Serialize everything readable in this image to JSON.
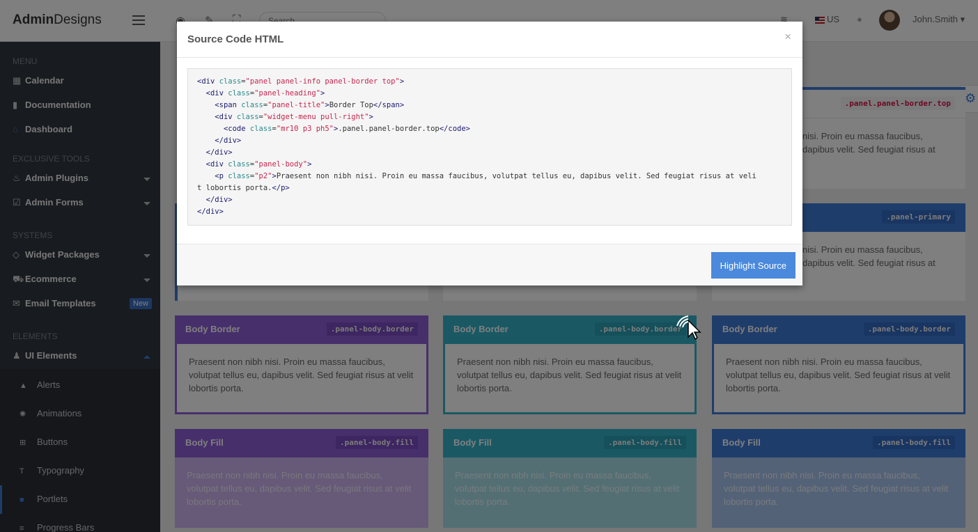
{
  "header": {
    "logo_bold": "Admin",
    "logo_rest": "Designs",
    "search_placeholder": "Search...",
    "language": "US",
    "username": "John.Smith"
  },
  "sidebar": {
    "sections": [
      "MENU",
      "EXCLUSIVE TOOLS",
      "SYSTEMS",
      "ELEMENTS"
    ],
    "menu": [
      {
        "label": "Calendar",
        "icon": "calendar-icon"
      },
      {
        "label": "Documentation",
        "icon": "book-icon"
      },
      {
        "label": "Dashboard",
        "icon": "home-icon"
      }
    ],
    "tools": [
      {
        "label": "Admin Plugins",
        "icon": "fire-icon"
      },
      {
        "label": "Admin Forms",
        "icon": "check-square-icon"
      }
    ],
    "systems": [
      {
        "label": "Widget Packages",
        "icon": "diamond-icon"
      },
      {
        "label": "Ecommerce",
        "icon": "cart-icon"
      },
      {
        "label": "Email Templates",
        "icon": "envelope-icon",
        "badge": "New"
      }
    ],
    "elements": [
      {
        "label": "UI Elements",
        "icon": "bell-icon"
      }
    ],
    "sub_items": [
      {
        "label": "Alerts",
        "icon": "warning-icon"
      },
      {
        "label": "Animations",
        "icon": "spinner-icon"
      },
      {
        "label": "Buttons",
        "icon": "plus-square-icon"
      },
      {
        "label": "Typography",
        "icon": "text-icon"
      },
      {
        "label": "Portlets",
        "icon": "portlet-icon"
      },
      {
        "label": "Progress Bars",
        "icon": "bars-icon"
      }
    ]
  },
  "panels": {
    "top_code": ".panel.panel-border.top",
    "primary_code": ".panel-primary",
    "body_text": "Praesent non nibh nisi. Proin eu massa faucibus, volutpat tellus eu, dapibus velit. Sed feugiat risus at velit lobortis porta.",
    "partial_text_1": "nisi. Proin eu massa faucibus,",
    "partial_text_2": "dapibus velit. Sed feugiat risus at",
    "border_title": "Body Border",
    "border_code": ".panel-body.border",
    "fill_title": "Body Fill",
    "fill_code": ".panel-body.fill"
  },
  "modal": {
    "title": "Source Code HTML",
    "close": "×",
    "button": "Highlight Source",
    "code_text_title": "Border Top",
    "code_text_code": ".panel.panel-border.top",
    "code_paragraph": "Praesent non nibh nisi. Proin eu massa faucibus, volutpat tellus eu, dapibus velit. Sed feugiat risus at veli",
    "code_paragraph_2": "t lobortis porta."
  },
  "colors": {
    "purple": "#8e5fd6",
    "teal": "#35b2c8",
    "blue": "#3f7ad6",
    "sidebar": "#30363e"
  }
}
